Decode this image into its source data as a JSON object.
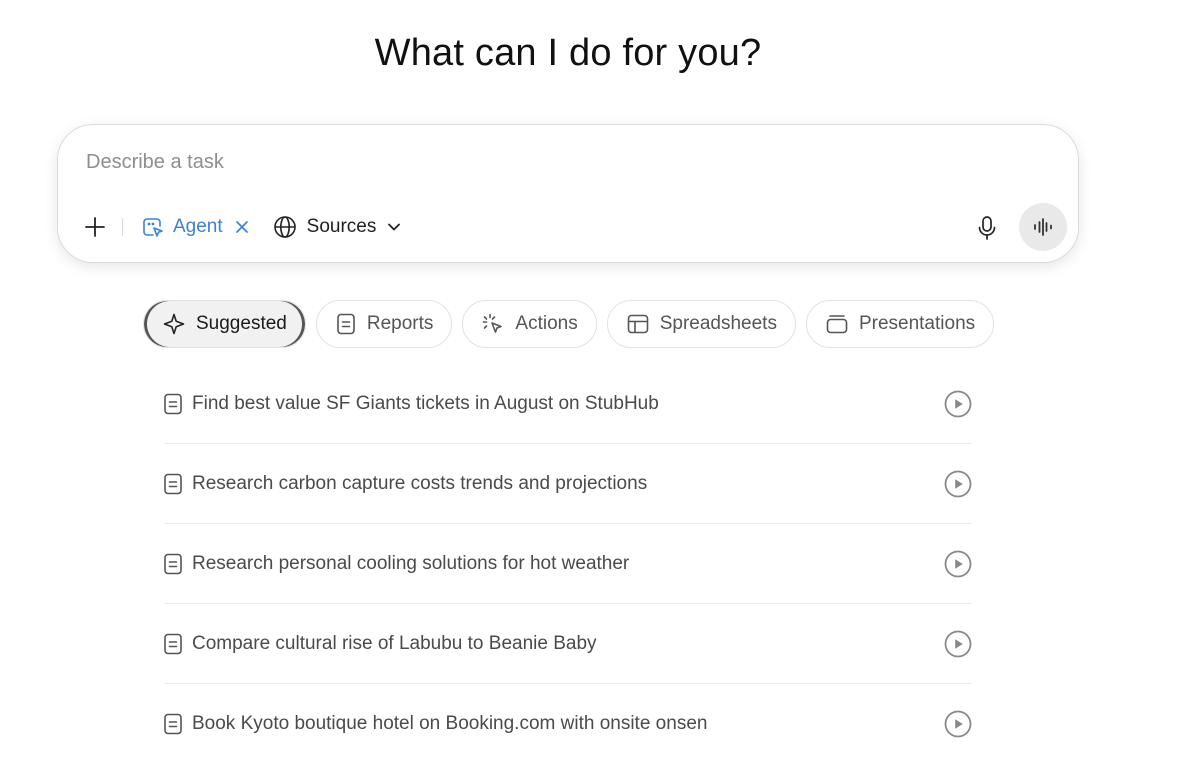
{
  "heading": "What can I do for you?",
  "composer": {
    "placeholder": "Describe a task",
    "agent_label": "Agent",
    "sources_label": "Sources",
    "accent_color": "#3b82d6"
  },
  "tabs": [
    {
      "label": "Suggested",
      "icon": "sparkle-icon",
      "active": true
    },
    {
      "label": "Reports",
      "icon": "document-icon",
      "active": false
    },
    {
      "label": "Actions",
      "icon": "cursor-click-icon",
      "active": false
    },
    {
      "label": "Spreadsheets",
      "icon": "table-icon",
      "active": false
    },
    {
      "label": "Presentations",
      "icon": "slides-icon",
      "active": false
    }
  ],
  "suggestions": [
    {
      "text": "Find best value SF Giants tickets in August on StubHub"
    },
    {
      "text": "Research carbon capture costs trends and projections"
    },
    {
      "text": "Research personal cooling solutions for hot weather"
    },
    {
      "text": "Compare cultural rise of Labubu to Beanie Baby"
    },
    {
      "text": "Book Kyoto boutique hotel on Booking.com with onsite onsen"
    }
  ]
}
